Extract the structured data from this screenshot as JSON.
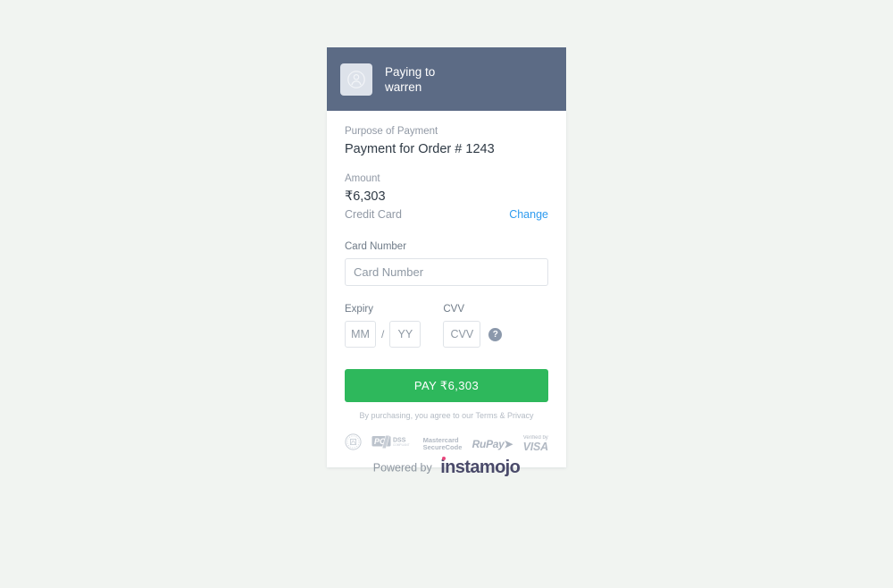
{
  "page": {
    "background_color": "#f1f4f1"
  },
  "header": {
    "paying_to_label": "Paying to",
    "merchant_name": "warren",
    "background_color": "#5c6b85",
    "avatar_icon": "user-avatar-icon"
  },
  "details": {
    "purpose_label": "Purpose of Payment",
    "purpose_value": "Payment for Order # 1243",
    "amount_label": "Amount",
    "amount_value": "₹6,303",
    "method_name": "Credit Card",
    "change_label": "Change",
    "change_color": "#2e9bef"
  },
  "form": {
    "card_number_label": "Card Number",
    "card_number_placeholder": "Card Number",
    "card_number_value": "",
    "expiry_label": "Expiry",
    "expiry_month_placeholder": "MM",
    "expiry_month_value": "",
    "expiry_separator": "/",
    "expiry_year_placeholder": "YY",
    "expiry_year_value": "",
    "cvv_label": "CVV",
    "cvv_placeholder": "CVV",
    "cvv_value": "",
    "cvv_help_icon": "question-mark-icon",
    "cvv_help_glyph": "?"
  },
  "pay": {
    "button_label": "PAY ₹6,303",
    "button_color": "#2eb85c",
    "terms_note": "By purchasing, you agree to our Terms & Privacy"
  },
  "badges": [
    {
      "name": "rbi-seal-badge",
      "label": "RBI"
    },
    {
      "name": "pci-dss-badge",
      "label": "PCI DSS"
    },
    {
      "name": "mastercard-securecode-badge",
      "line1": "Mastercard",
      "line2": "SecureCode"
    },
    {
      "name": "rupay-badge",
      "label": "RuPay"
    },
    {
      "name": "verified-by-visa-badge",
      "line1": "Verified by",
      "line2": "VISA"
    }
  ],
  "footer": {
    "powered_by_text": "Powered by",
    "brand_name": "instamojo",
    "brand_color": "#4a4a6a",
    "brand_dot_color": "#e8467c"
  }
}
